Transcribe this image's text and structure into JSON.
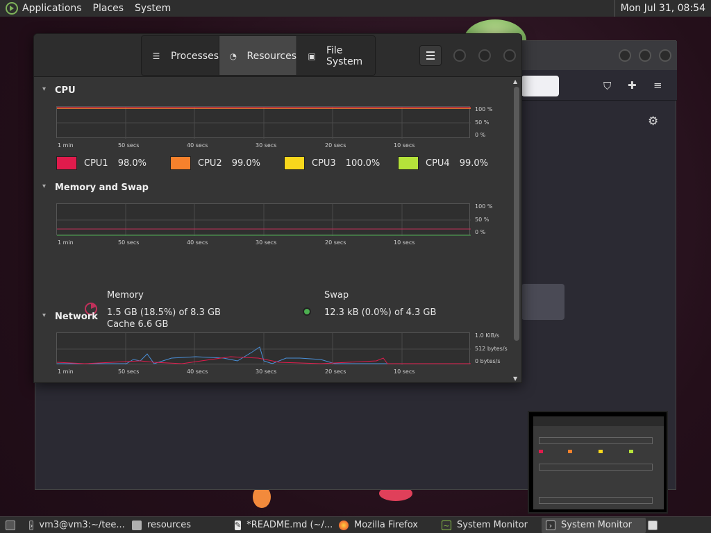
{
  "top_panel": {
    "menus": [
      "Applications",
      "Places",
      "System"
    ],
    "clock": "Mon Jul 31, 08:54"
  },
  "sysmon": {
    "tabs": [
      {
        "label": "Processes",
        "icon": "list-icon"
      },
      {
        "label": "Resources",
        "icon": "gauge-icon"
      },
      {
        "label": "File System",
        "icon": "disk-icon"
      }
    ],
    "cpu": {
      "title": "CPU",
      "y_ticks": [
        "100 %",
        "50 %",
        "0 %"
      ],
      "x_ticks": [
        "1 min",
        "50 secs",
        "40 secs",
        "30 secs",
        "20 secs",
        "10 secs"
      ],
      "cores": [
        {
          "name": "CPU1",
          "value": "98.0%",
          "color": "#e01b4c"
        },
        {
          "name": "CPU2",
          "value": "99.0%",
          "color": "#f6812c"
        },
        {
          "name": "CPU3",
          "value": "100.0%",
          "color": "#f8d71c"
        },
        {
          "name": "CPU4",
          "value": "99.0%",
          "color": "#b5e33a"
        }
      ]
    },
    "memory": {
      "title": "Memory and Swap",
      "y_ticks": [
        "100 %",
        "50 %",
        "0 %"
      ],
      "x_ticks": [
        "1 min",
        "50 secs",
        "40 secs",
        "30 secs",
        "20 secs",
        "10 secs"
      ],
      "memory_label": "Memory",
      "memory_usage": "1.5 GB (18.5%) of 8.3 GB",
      "memory_cache": "Cache 6.6 GB",
      "memory_color": "#c0305a",
      "swap_label": "Swap",
      "swap_usage": "12.3 kB (0.0%) of 4.3 GB",
      "swap_color": "#4caf50"
    },
    "network": {
      "title": "Network",
      "y_ticks": [
        "1.0 KiB/s",
        "512 bytes/s",
        "0 bytes/s"
      ],
      "x_ticks": [
        "1 min",
        "50 secs",
        "40 secs",
        "30 secs",
        "20 secs",
        "10 secs"
      ]
    }
  },
  "taskbar": {
    "items": [
      {
        "label": "vm3@vm3:~/tee...",
        "icon": "terminal-icon"
      },
      {
        "label": "resources",
        "icon": "folder-icon"
      },
      {
        "label": "*README.md (~/...",
        "icon": "text-editor-icon"
      },
      {
        "label": "Mozilla Firefox",
        "icon": "firefox-icon"
      },
      {
        "label": "System Monitor",
        "icon": "system-monitor-icon"
      },
      {
        "label": "System Monitor",
        "icon": "system-monitor-icon"
      }
    ]
  }
}
